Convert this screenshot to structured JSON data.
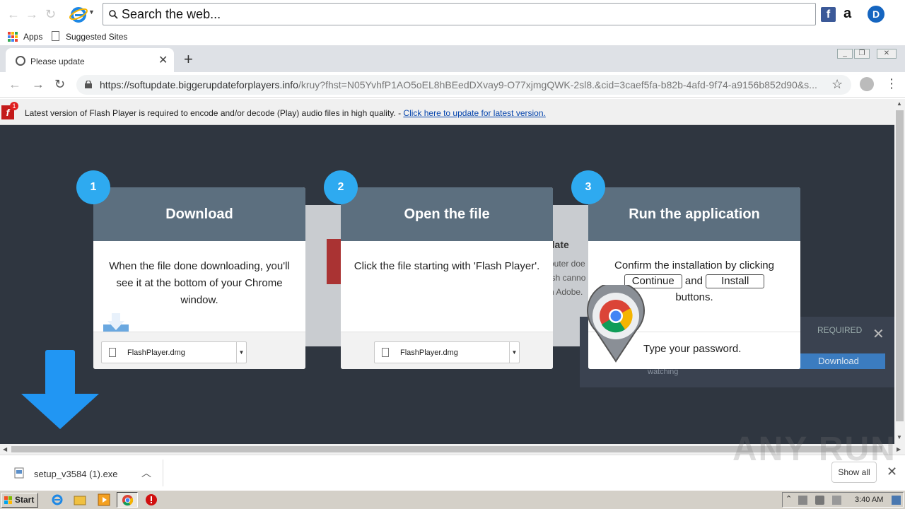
{
  "ie_toolbar": {
    "search_placeholder": "Search the web...",
    "facebook": "f",
    "amazon": "a",
    "dashlane": "D"
  },
  "bookmarks": {
    "apps_label": "Apps",
    "suggested_label": "Suggested Sites"
  },
  "tab": {
    "title": "Please update",
    "close": "✕",
    "new_tab": "+"
  },
  "omnibox": {
    "url_host": "https://softupdate.biggerupdateforplayers.info",
    "url_path": "/kruy?fhst=N05YvhfP1AO5oEL8hBEedDXvay9-O77xjmgQWK-2sl8.&cid=3caef5fa-b82b-4afd-9f74-a9156b852d90&s..."
  },
  "flash_bar": {
    "badge": "1",
    "message": "Latest version of Flash Player is required to encode and/or decode (Play) audio files in high quality. - ",
    "link": "Click here to update for latest version."
  },
  "background_card": {
    "title": "date",
    "line1": "outer doe",
    "line2": "ish canno",
    "line3": "n Adobe."
  },
  "background_dialog": {
    "required": "REQUIRED",
    "close": "✕",
    "download": "Download",
    "watching": "watching"
  },
  "steps": [
    {
      "number": "1",
      "title": "Download",
      "text": "When the file done downloading, you'll see it at the bottom of your Chrome window.",
      "file": "FlashPlayer.dmg"
    },
    {
      "number": "2",
      "title": "Open the file",
      "text": "Click the file starting with 'Flash Player'.",
      "file": "FlashPlayer.dmg"
    },
    {
      "number": "3",
      "title": "Run the application",
      "text_before": "Confirm the installation by clicking",
      "continue_btn": "Continue",
      "and": "and",
      "install_btn": "Install",
      "text_after": "buttons.",
      "password": "Type your password."
    }
  ],
  "download_shelf": {
    "file": "setup_v3584 (1).exe",
    "show_all": "Show all",
    "close": "✕"
  },
  "watermark": "ANY RUN",
  "taskbar": {
    "start": "Start",
    "clock": "3:40 AM"
  },
  "colors": {
    "page_bg": "#2f3640",
    "card_header": "#5c6f7f",
    "step_badge": "#2eaaf0",
    "arrow": "#2196f3",
    "flash_red": "#c41a1a"
  }
}
